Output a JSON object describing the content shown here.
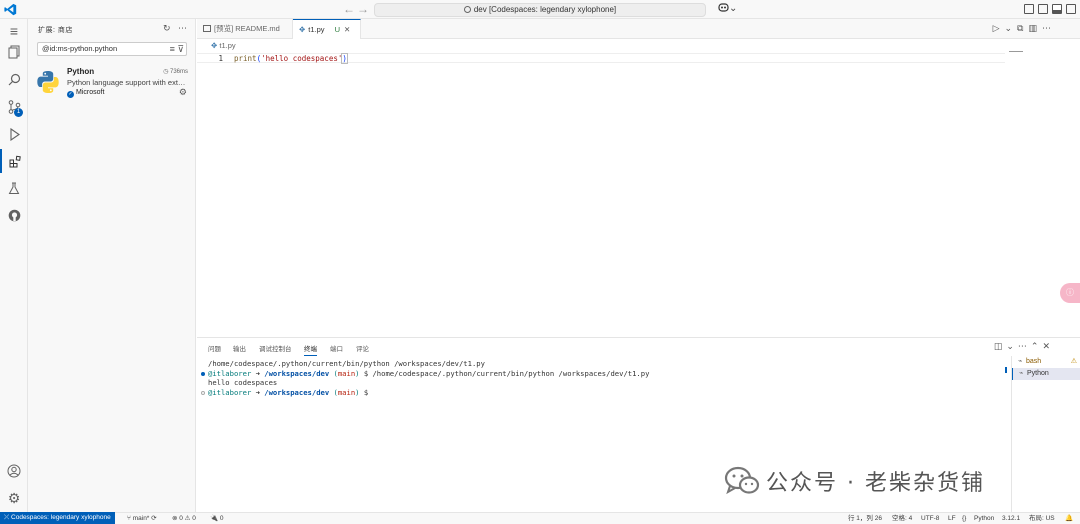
{
  "titlebar": {
    "back": "←",
    "forward": "→",
    "search_text": "dev [Codespaces: legendary xylophone]",
    "copilot": "⌄"
  },
  "activity": {
    "source_control_badge": "1"
  },
  "sidebar": {
    "title": "扩展: 商店",
    "search_value": "@id:ms-python.python",
    "extension": {
      "name": "Python",
      "time": "736ms",
      "description": "Python language support with extension access points for IntelliSense (Pylance), Debugging (Python Debugger), linting, formatting, refactoring, unit tests, and more.",
      "publisher": "Microsoft"
    }
  },
  "tabs": [
    {
      "label": "[预览] README.md"
    },
    {
      "label": "t1.py",
      "status": "U",
      "close": "✕"
    }
  ],
  "editor": {
    "breadcrumb": "t1.py",
    "line_number": "1",
    "code_fn": "print",
    "code_open": "(",
    "code_str": "'hello codespaces'",
    "code_close": ")"
  },
  "panel": {
    "tabs": [
      "问题",
      "输出",
      "调试控制台",
      "终端",
      "端口",
      "评论"
    ],
    "active_tab": "终端",
    "terminal_lines": {
      "l1": "/home/codespace/.python/current/bin/python /workspaces/dev/t1.py",
      "user": "@itlaborer",
      "arrow": "➜",
      "path": "/workspaces/dev",
      "branch_open": "(",
      "branch": "main",
      "branch_close": ")",
      "cmd": "$ /home/codespace/.python/current/bin/python /workspaces/dev/t1.py",
      "output": "hello codespaces",
      "prompt": "$"
    },
    "terminals": [
      {
        "label": "bash",
        "warn": "⚠"
      },
      {
        "label": "Python"
      }
    ]
  },
  "statusbar": {
    "remote": "Codespaces: legendary xylophone",
    "branch": "main*",
    "sync": "⟳",
    "problems": "⊗ 0 ⚠ 0",
    "ports": "🔌 0",
    "position": "行 1，列 26",
    "spaces": "空格: 4",
    "encoding": "UTF-8",
    "eol": "LF",
    "braces": "{}",
    "language": "Python",
    "version": "3.12.1",
    "layout": "布局: US",
    "bell": "🔔"
  },
  "watermark": {
    "text": "公众号 · 老柴杂货铺"
  },
  "float_button": "ⓘ"
}
